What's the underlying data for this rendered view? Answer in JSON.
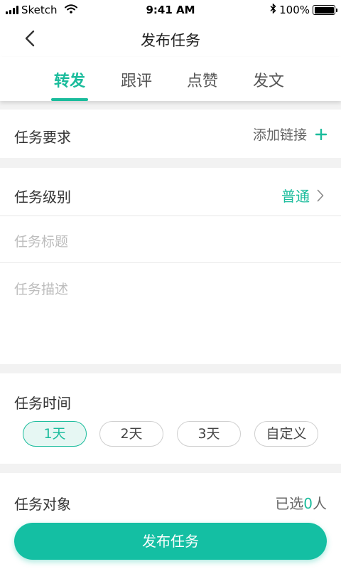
{
  "status_bar": {
    "carrier": "Sketch",
    "time": "9:41 AM",
    "battery": "100%",
    "icons": [
      "signal-icon",
      "wifi-icon",
      "bluetooth-icon",
      "battery-icon"
    ]
  },
  "nav": {
    "title": "发布任务",
    "back_icon": "chevron-left-icon"
  },
  "tabs": [
    {
      "label": "转发",
      "active": true
    },
    {
      "label": "跟评",
      "active": false
    },
    {
      "label": "点赞",
      "active": false
    },
    {
      "label": "发文",
      "active": false
    }
  ],
  "requirements": {
    "label": "任务要求",
    "action": "添加链接",
    "action_icon": "plus-icon"
  },
  "level": {
    "label": "任务级别",
    "value": "普通",
    "icon": "chevron-right-icon"
  },
  "title_field": {
    "placeholder": "任务标题"
  },
  "description_field": {
    "placeholder": "任务描述"
  },
  "time": {
    "label": "任务时间",
    "options": [
      {
        "label": "1天",
        "selected": true
      },
      {
        "label": "2天",
        "selected": false
      },
      {
        "label": "3天",
        "selected": false
      },
      {
        "label": "自定义",
        "selected": false
      }
    ]
  },
  "target": {
    "label": "任务对象",
    "prefix": "已选",
    "count": "0",
    "suffix": "人"
  },
  "publish_button": {
    "label": "发布任务"
  },
  "colors": {
    "accent": "#1abc9c",
    "button": "#14bfa3",
    "background": "#f2f2f2"
  }
}
